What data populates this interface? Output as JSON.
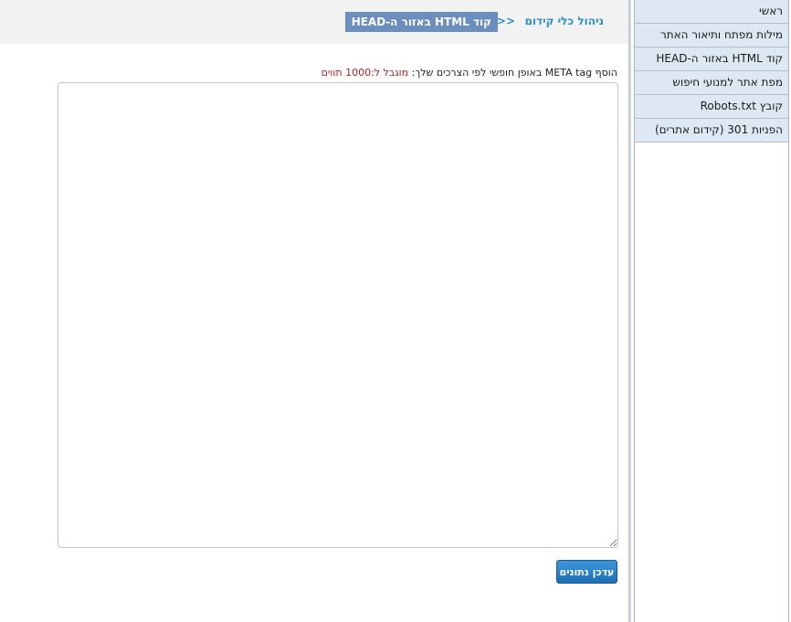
{
  "breadcrumb": {
    "root": "ניהול כלי קידום",
    "separator": ">>",
    "current": "קוד HTML באזור ה-HEAD"
  },
  "sidebar": {
    "items": [
      {
        "label": "ראשי"
      },
      {
        "label": "מילות מפתח ותיאור האתר"
      },
      {
        "label": "קוד HTML באזור ה-HEAD"
      },
      {
        "label": "מפת אתר למנועי חיפוש"
      },
      {
        "label": "קובץ Robots.txt"
      },
      {
        "label": "הפניות 301 (קידום אתרים)"
      }
    ]
  },
  "form": {
    "instruction": "הוסף META tag באופן חופשי לפי הצרכים שלך:",
    "limit": "מוגבל ל:1000 תווים",
    "textarea_value": "",
    "save_label": "עדכן נתונים"
  }
}
